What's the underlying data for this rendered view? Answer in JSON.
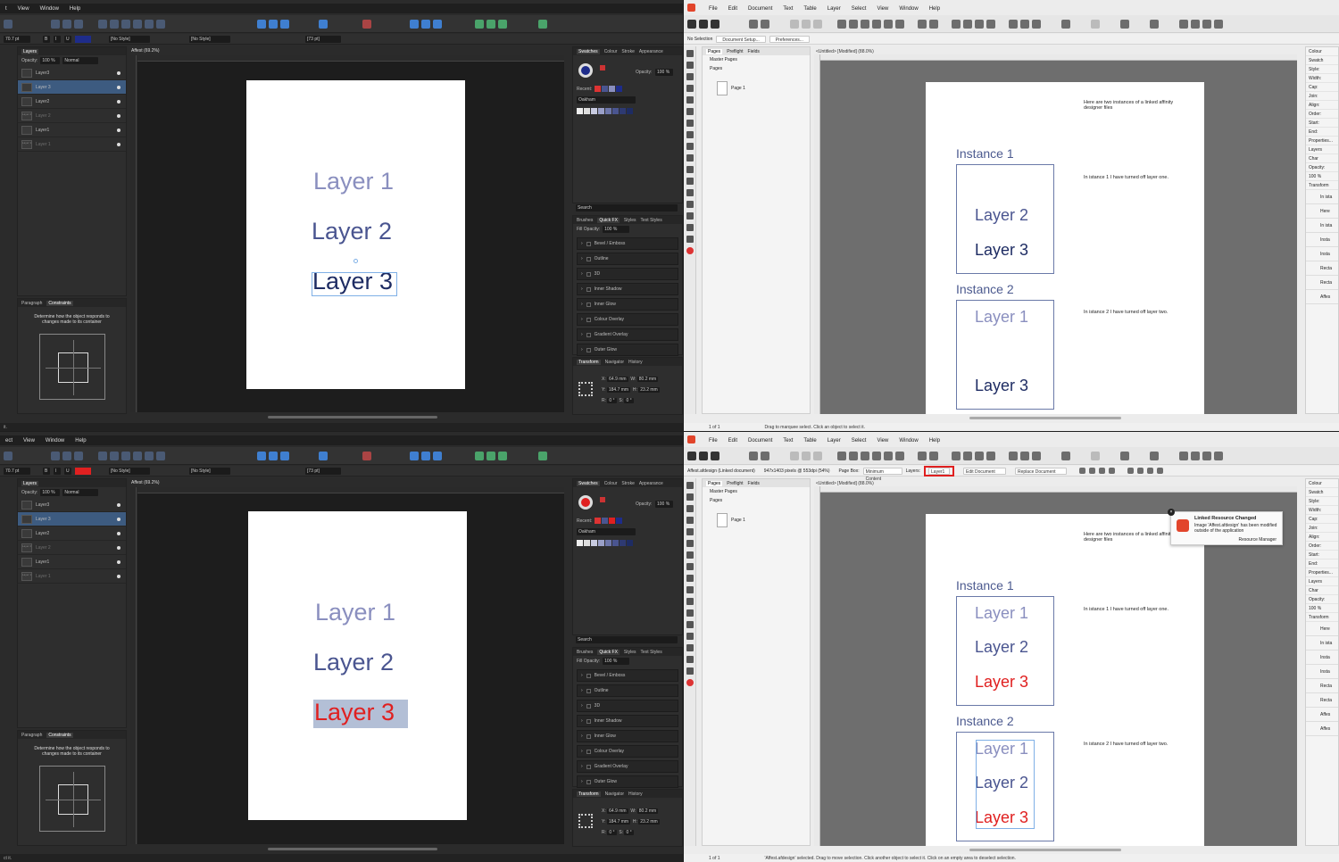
{
  "tl": {
    "menu": [
      "t",
      "View",
      "Window",
      "Help"
    ],
    "font_size_field": "70.7 pt",
    "style_field": "[No Style]",
    "style_field2": "[No Style]",
    "size2": "[73 pt]",
    "layers_tab": "Layers",
    "opacity_label": "Opacity:",
    "opacity_value": "100 %",
    "blend_mode": "Normal",
    "layers": [
      {
        "label": "Layer3",
        "sub": "",
        "state": "normal"
      },
      {
        "label": "Layer 3",
        "sub": "",
        "state": "selected"
      },
      {
        "label": "Layer2",
        "sub": "",
        "state": "normal"
      },
      {
        "label": "Layer 2",
        "sub": "Layer 2",
        "state": "dim"
      },
      {
        "label": "Layer1",
        "sub": "",
        "state": "normal"
      },
      {
        "label": "Layer 1",
        "sub": "Layer 1",
        "state": "dim"
      }
    ],
    "bottom_tabs": [
      "Paragraph",
      "Constraints"
    ],
    "constraints_text": "Determine how the object responds to changes made to its container",
    "doc_tab": "Affest (69.2%)",
    "canvas_text": [
      "Layer 1",
      "Layer 2",
      "Layer 3"
    ],
    "swatch_tabs": [
      "Swatches",
      "Colour",
      "Stroke",
      "Appearance"
    ],
    "opacity2": "100 %",
    "recent_label": "Recent:",
    "palette": "Oakham",
    "search_placeholder": "Search",
    "fx_tabs": [
      "Brushes",
      "Quick FX",
      "Styles",
      "Text Styles"
    ],
    "fill_opacity_label": "Fill Opacity:",
    "fill_opacity": "100 %",
    "fx_items": [
      "Bevel / Emboss",
      "Outline",
      "3D",
      "Inner Shadow",
      "Inner Glow",
      "Colour Overlay",
      "Gradient Overlay",
      "Outer Glow"
    ],
    "transform_tabs": [
      "Transform",
      "Navigator",
      "History"
    ],
    "transform": {
      "x": "64.9 mm",
      "y": "184.7 mm",
      "w": "80.2 mm",
      "h": "23.2 mm",
      "r": "0 °",
      "s": "0 °"
    },
    "status": "it."
  },
  "bl": {
    "menu": [
      "ect",
      "View",
      "Window",
      "Help"
    ],
    "font_size_field": "70.7 pt",
    "style_field": "[No Style]",
    "style_field2": "[No Style]",
    "size2": "[73 pt]",
    "layers_tab": "Layers",
    "opacity_label": "Opacity:",
    "opacity_value": "100 %",
    "blend_mode": "Normal",
    "layers": [
      {
        "label": "Layer3",
        "sub": "",
        "state": "normal"
      },
      {
        "label": "Layer 3",
        "sub": "",
        "state": "selected"
      },
      {
        "label": "Layer2",
        "sub": "",
        "state": "normal"
      },
      {
        "label": "Layer 2",
        "sub": "Layer 2",
        "state": "dim"
      },
      {
        "label": "Layer1",
        "sub": "",
        "state": "normal"
      },
      {
        "label": "Layer 1",
        "sub": "Layer 1",
        "state": "dim"
      }
    ],
    "bottom_tabs": [
      "Paragraph",
      "Constraints"
    ],
    "constraints_text": "Determine how the object responds to changes made to its container",
    "doc_tab": "Affest (69.2%)",
    "canvas_text": [
      "Layer 1",
      "Layer 2",
      "Layer 3"
    ],
    "swatch_tabs": [
      "Swatches",
      "Colour",
      "Stroke",
      "Appearance"
    ],
    "opacity2": "100 %",
    "recent_label": "Recent:",
    "palette": "Oakham",
    "search_placeholder": "Search",
    "fx_tabs": [
      "Brushes",
      "Quick FX",
      "Styles",
      "Text Styles"
    ],
    "fill_opacity_label": "Fill Opacity:",
    "fill_opacity": "100 %",
    "fx_items": [
      "Bevel / Emboss",
      "Outline",
      "3D",
      "Inner Shadow",
      "Inner Glow",
      "Colour Overlay",
      "Gradient Overlay",
      "Outer Glow"
    ],
    "transform_tabs": [
      "Transform",
      "Navigator",
      "History"
    ],
    "transform": {
      "x": "64.9 mm",
      "y": "184.7 mm",
      "w": "80.2 mm",
      "h": "23.2 mm",
      "r": "0 °",
      "s": "0 °"
    },
    "status": "ct it."
  },
  "tr": {
    "menu": [
      "File",
      "Edit",
      "Document",
      "Text",
      "Table",
      "Layer",
      "Select",
      "View",
      "Window",
      "Help"
    ],
    "ctx_items": [
      "No Selection",
      "Document Setup...",
      "Preferences..."
    ],
    "pages_tabs": [
      "Pages",
      "Preflight",
      "Fields"
    ],
    "master_pages": "Master Pages",
    "pages": "Pages",
    "page1": "Page 1",
    "doc_tab": "<Untitled> [Modified] (88.0%)",
    "intro_note": "Here are two instances of a linked affinity designer files",
    "instance1": "Instance 1",
    "instance1_items": [
      "Layer 2",
      "Layer 3"
    ],
    "note1": "In istance 1 I have turned off layer one.",
    "instance2": "Instance 2",
    "instance2_items": [
      "Layer 1",
      "Layer 3"
    ],
    "note2": "In istance 2 I have turned off layer two.",
    "right_labels": [
      "Colour",
      "Swatch",
      "Style:",
      "Width:",
      "Cap:",
      "Join:",
      "Align:",
      "Order:",
      "Start:",
      "End:",
      "Properties...",
      "Layers",
      "Char",
      "Opacity:",
      "100 %",
      "Transform"
    ],
    "right_layers": [
      "In ista",
      "Here",
      "In ista",
      "Insta",
      "Insta",
      "Recta",
      "Recta",
      "Affes"
    ],
    "page_nav": "1 of 1",
    "status": "Drag to marquee select. Click an object to select it."
  },
  "br": {
    "menu": [
      "File",
      "Edit",
      "Document",
      "Text",
      "Table",
      "Layer",
      "Select",
      "View",
      "Window",
      "Help"
    ],
    "ctx_items": [
      "Affest.afdesign (Linked document)",
      "947x1403 pixels @ 553dpi (54%)",
      "Page Box:",
      "Minimum Content",
      "Layers:",
      "Layer1",
      "Edit Document",
      "Replace Document"
    ],
    "pages_tabs": [
      "Pages",
      "Preflight",
      "Fields"
    ],
    "master_pages": "Master Pages",
    "pages": "Pages",
    "page1": "Page 1",
    "doc_tab": "<Untitled> [Modified] (88.0%)",
    "intro_note": "Here are two instances of a linked affinity designer files",
    "instance1": "Instance 1",
    "instance1_items": [
      "Layer 1",
      "Layer 2",
      "Layer 3"
    ],
    "note1": "In istance 1 I have turned off layer one.",
    "instance2": "Instance 2",
    "instance2_items": [
      "Layer 1",
      "Layer 2",
      "Layer 3"
    ],
    "note2": "In istance 2 I have turned off layer two.",
    "notification": {
      "title": "Linked Resource Changed",
      "body": "Image 'Affest.afdesign' has been modified outside of the application",
      "action": "Resource Manager"
    },
    "right_labels": [
      "Colour",
      "Swatch",
      "Style:",
      "Width:",
      "Cap:",
      "Join:",
      "Align:",
      "Order:",
      "Start:",
      "End:",
      "Properties...",
      "Layers",
      "Char",
      "Opacity:",
      "100 %",
      "Transform"
    ],
    "right_layers": [
      "Here",
      "In ista",
      "Insta",
      "Insta",
      "Recta",
      "Recta",
      "Affes",
      "Affes"
    ],
    "page_nav": "1 of 1",
    "status": "'Affest.afdesign' selected. Drag to move selection. Click another object to select it. Click on an empty area to deselect selection."
  },
  "colors": {
    "layer1_text": "#8a8fbf",
    "layer2_text": "#4a5590",
    "layer3_text": "#1e2c63",
    "red_text": "#e02020",
    "highlight": "#e02020",
    "selection": "#3d5b80"
  }
}
